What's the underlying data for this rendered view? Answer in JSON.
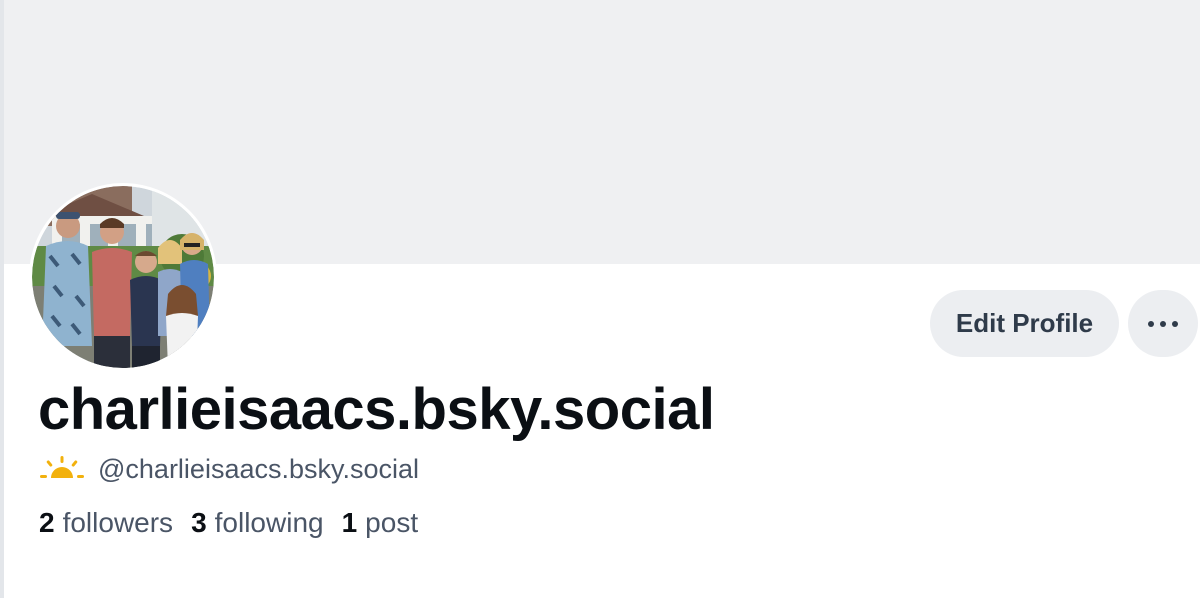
{
  "profile": {
    "display_name": "charlieisaacs.bsky.social",
    "handle": "@charlieisaacs.bsky.social",
    "handle_emoji_icon": "sunrise-icon",
    "avatar_icon": "family-photo-avatar"
  },
  "actions": {
    "edit_profile_label": "Edit Profile",
    "more_icon": "ellipsis-icon"
  },
  "stats": {
    "followers_count": "2",
    "followers_label": "followers",
    "following_count": "3",
    "following_label": "following",
    "posts_count": "1",
    "posts_label": "post"
  },
  "colors": {
    "banner": "#eff0f2",
    "button_bg": "#eceef1",
    "button_text": "#2f3b4a",
    "muted_text": "#4a5566",
    "strong_text": "#0b0f14",
    "sun": "#f2b10d"
  }
}
